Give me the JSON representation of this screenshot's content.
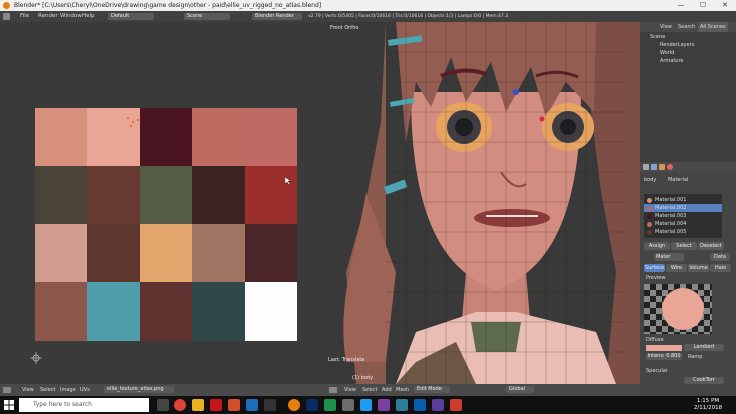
{
  "window": {
    "title": "Blender* [C:\\Users\\Cheryl\\OneDrive\\drawing\\game design\\other - paid\\ellie_uv_rigged_no_atlas.blend]",
    "minimize": "—",
    "maximize": "☐",
    "close": "✕"
  },
  "menu": {
    "items": [
      "File",
      "Render",
      "Window",
      "Help"
    ],
    "layout": "Default",
    "scene": "Scene",
    "engine": "Blender Render",
    "stats": "v2.79 | Verts:0/5405 | Faces:0/10616 | Tris:0/10616 | Objects:1/3 | Lamps:0/0 | Mem:47.38M | body"
  },
  "uv_editor": {
    "menus": [
      "View",
      "Select",
      "Image",
      "UVs"
    ],
    "image_name": "ellie_texture_atlas.png",
    "swatch_colors": [
      [
        "#d7907c",
        "#e9a596",
        "#4a1520",
        "#bf6a60",
        "#c06a66"
      ],
      [
        "#4a4438",
        "#673a31",
        "#545c45",
        "#3c2220",
        "#9a2f2b"
      ],
      [
        "#d19d91",
        "#5e3731",
        "#e3a66d",
        "#9e7462",
        "#4a2628"
      ],
      [
        "#8c564b",
        "#4f9cab",
        "#5e322e",
        "#2f4749",
        "#fefefe"
      ]
    ]
  },
  "viewport": {
    "label": "Front Ortho",
    "operator": "Last: Translate",
    "object_label": "(1) body",
    "menus": [
      "View",
      "Select",
      "Add",
      "Mesh"
    ],
    "mode": "Edit Mode",
    "pivot": "Global"
  },
  "outliner": {
    "tabs": [
      "View",
      "Search",
      "All Scenes"
    ],
    "items": [
      "Scene",
      "RenderLayers",
      "World",
      "Armature"
    ]
  },
  "properties": {
    "object": "body",
    "material_tab": "Material",
    "materials": [
      "Material.001",
      "Material.002",
      "Material.003",
      "Material.004",
      "Material.005"
    ],
    "material_colors": [
      "#d7907c",
      "#c06a66",
      "#4a1520",
      "#bf6a60",
      "#673a31"
    ],
    "buttons": [
      "Assign",
      "Select",
      "Deselect"
    ],
    "mat_name": "Mater",
    "data_label": "Data",
    "sub_tabs": [
      "Surface",
      "Wire",
      "Volume",
      "Halo"
    ],
    "preview_label": "Preview",
    "diffuse_label": "Diffuse",
    "diffuse_shader": "Lambert",
    "intensity": "Intens: 0.800",
    "ramp": "Ramp",
    "specular_label": "Specular",
    "specular_shader": "CookTorr",
    "diffuse_color": "#e9a596"
  },
  "taskbar": {
    "search_placeholder": "Type here to search",
    "time": "1:15 PM",
    "date": "2/11/2018"
  }
}
